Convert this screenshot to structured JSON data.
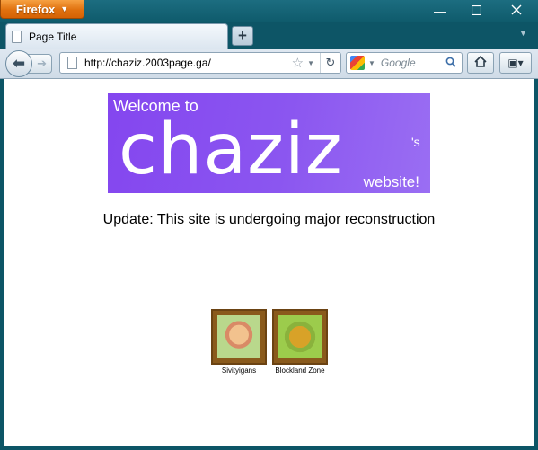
{
  "browser": {
    "menu_button": "Firefox",
    "tab_title": "Page Title",
    "new_tab_symbol": "+",
    "url": "http://chaziz.2003page.ga/",
    "search_placeholder": "Google"
  },
  "page": {
    "banner": {
      "welcome": "Welcome to",
      "name": "chaziz",
      "possessive": "'s",
      "website": "website!"
    },
    "update_text": "Update: This site is undergoing major reconstruction",
    "links": [
      {
        "label": "Sivityigans",
        "icon": "cartoon-character-icon"
      },
      {
        "label": "Blockland Zone",
        "icon": "frog-character-icon"
      }
    ]
  },
  "colors": {
    "titlebar": "#0f5b6c",
    "firefox_button": "#e0710f",
    "banner_purple": "#8446ef",
    "frame_brown": "#8a5a1c"
  }
}
